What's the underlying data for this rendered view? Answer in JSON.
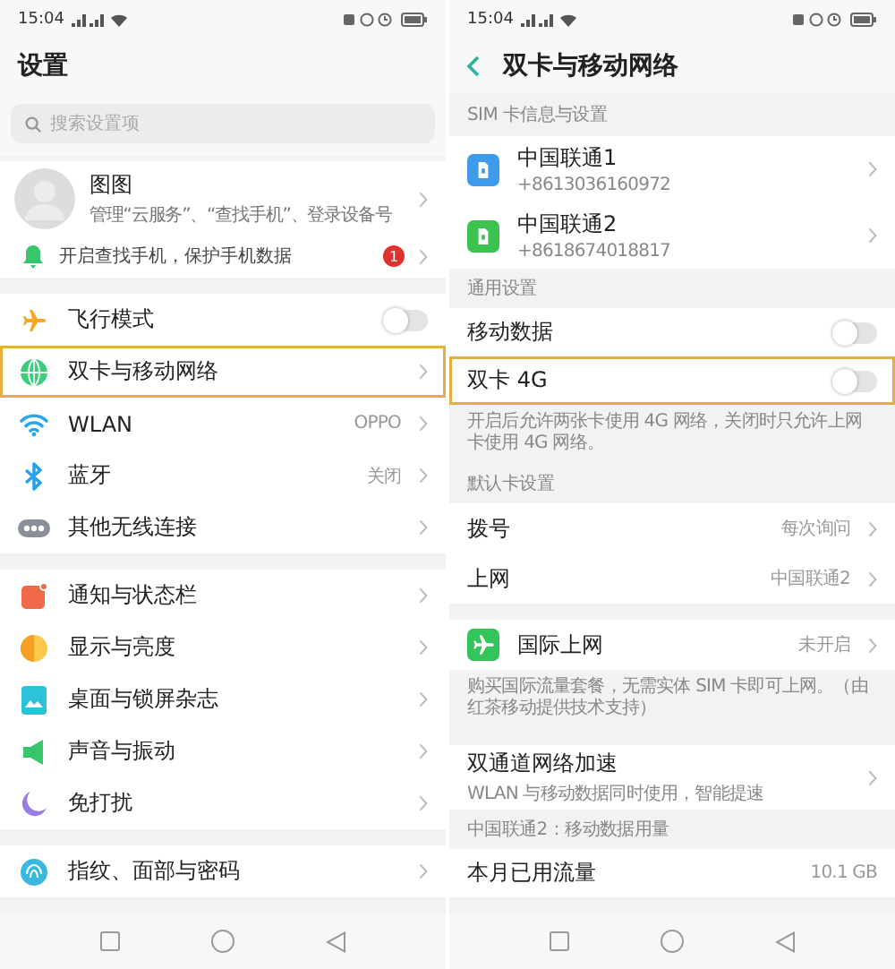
{
  "settings": {
    "status_bar": {
      "time": "15:04"
    },
    "title": "设置",
    "search": {
      "placeholder": "搜索设置项"
    },
    "account": {
      "name": "图图",
      "subtitle": "管理“云服务”、“查找手机”、登录设备号"
    },
    "notice": {
      "text": "开启查找手机，保护手机数据",
      "badge": "1"
    },
    "sections": [
      {
        "rows": [
          {
            "kind": "toggle",
            "label": "飞行模式",
            "on": false,
            "highlighted": false
          },
          {
            "kind": "link",
            "label": "双卡与移动网络",
            "highlighted": true
          },
          {
            "kind": "link",
            "label": "WLAN",
            "value": "OPPO",
            "highlighted": false
          },
          {
            "kind": "link",
            "label": "蓝牙",
            "value": "关闭",
            "highlighted": false
          },
          {
            "kind": "link",
            "label": "其他无线连接",
            "highlighted": false
          }
        ]
      },
      {
        "rows": [
          {
            "kind": "link",
            "label": "通知与状态栏",
            "highlighted": false
          },
          {
            "kind": "link",
            "label": "显示与亮度",
            "highlighted": false
          },
          {
            "kind": "link",
            "label": "桌面与锁屏杂志",
            "highlighted": false
          },
          {
            "kind": "link",
            "label": "声音与振动",
            "highlighted": false
          },
          {
            "kind": "link",
            "label": "免打扰",
            "highlighted": false
          }
        ]
      },
      {
        "rows": [
          {
            "kind": "link",
            "label": "指纹、面部与密码",
            "highlighted": false
          }
        ]
      }
    ]
  },
  "dual_sim": {
    "status_bar": {
      "time": "15:04"
    },
    "title": "双卡与移动网络",
    "sections": [
      {
        "header": "SIM 卡信息与设置",
        "rows": [
          {
            "kind": "sim",
            "label": "中国联通1",
            "subtitle": "+8613036160972",
            "color": "#3d9be9",
            "highlighted": false
          },
          {
            "kind": "sim",
            "label": "中国联通2",
            "subtitle": "+8618674018817",
            "color": "#3cc24f",
            "highlighted": false
          }
        ]
      },
      {
        "header": "通用设置",
        "rows": [
          {
            "kind": "toggle",
            "label": "移动数据",
            "on": false,
            "highlighted": false
          },
          {
            "kind": "toggle",
            "label": "双卡 4G",
            "on": false,
            "highlighted": true
          }
        ],
        "note": "开启后允许两张卡使用 4G 网络，关闭时只允许上网卡使用 4G 网络。"
      },
      {
        "header": "默认卡设置",
        "rows": [
          {
            "kind": "link",
            "label": "拨号",
            "value": "每次询问",
            "highlighted": false
          },
          {
            "kind": "link",
            "label": "上网",
            "value": "中国联通2",
            "highlighted": false
          }
        ]
      },
      {
        "rows": [
          {
            "kind": "app",
            "label": "国际上网",
            "value": "未开启",
            "highlighted": false
          }
        ],
        "note": "购买国际流量套餐，无需实体 SIM 卡即可上网。（由红茶移动提供技术支持）"
      },
      {
        "rows": [
          {
            "kind": "link",
            "label": "双通道网络加速",
            "subtitle": "WLAN 与移动数据同时使用，智能提速",
            "highlighted": false
          }
        ]
      },
      {
        "header": "中国联通2：移动数据用量",
        "rows": [
          {
            "kind": "value",
            "label": "本月已用流量",
            "value": "10.1 GB",
            "highlighted": false
          }
        ]
      }
    ]
  }
}
